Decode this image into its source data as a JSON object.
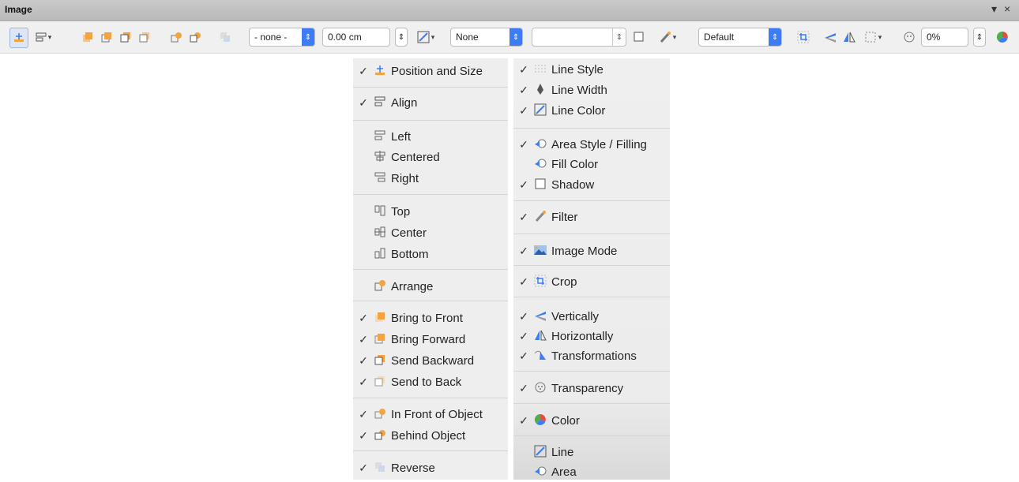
{
  "window": {
    "title": "Image",
    "dropdown_glyph": "▾",
    "close_glyph": "×"
  },
  "toolbar": {
    "line_style_value": "- none -",
    "line_width_value": "0.00 cm",
    "area_style_value": "None",
    "fill_value": "",
    "image_mode_value": "Default",
    "transparency_value": "0%"
  },
  "left_menu": [
    {
      "checked": true,
      "icon": "position-size-icon",
      "label": "Position and Size"
    },
    {
      "checked": true,
      "icon": "align-icon",
      "label": "Align"
    },
    {
      "checked": false,
      "icon": "align-left-icon",
      "label": "Left"
    },
    {
      "checked": false,
      "icon": "align-centered-icon",
      "label": "Centered"
    },
    {
      "checked": false,
      "icon": "align-right-icon",
      "label": "Right"
    },
    {
      "checked": false,
      "icon": "align-top-icon",
      "label": "Top"
    },
    {
      "checked": false,
      "icon": "align-center-icon",
      "label": "Center"
    },
    {
      "checked": false,
      "icon": "align-bottom-icon",
      "label": "Bottom"
    },
    {
      "checked": false,
      "icon": "arrange-icon",
      "label": "Arrange"
    },
    {
      "checked": true,
      "icon": "bring-to-front-icon",
      "label": "Bring to Front"
    },
    {
      "checked": true,
      "icon": "bring-forward-icon",
      "label": "Bring Forward"
    },
    {
      "checked": true,
      "icon": "send-backward-icon",
      "label": "Send Backward"
    },
    {
      "checked": true,
      "icon": "send-to-back-icon",
      "label": "Send to Back"
    },
    {
      "checked": true,
      "icon": "in-front-of-object-icon",
      "label": "In Front of Object"
    },
    {
      "checked": true,
      "icon": "behind-object-icon",
      "label": "Behind Object"
    },
    {
      "checked": true,
      "icon": "reverse-icon",
      "label": "Reverse"
    }
  ],
  "right_menu": [
    {
      "checked": true,
      "icon": "line-style-icon",
      "label": "Line Style"
    },
    {
      "checked": true,
      "icon": "line-width-icon",
      "label": "Line Width"
    },
    {
      "checked": true,
      "icon": "line-color-icon",
      "label": "Line Color"
    },
    {
      "checked": true,
      "icon": "area-style-icon",
      "label": "Area Style / Filling"
    },
    {
      "checked": false,
      "icon": "fill-color-icon",
      "label": "Fill Color"
    },
    {
      "checked": true,
      "icon": "shadow-icon",
      "label": "Shadow"
    },
    {
      "checked": true,
      "icon": "filter-icon",
      "label": "Filter"
    },
    {
      "checked": true,
      "icon": "image-mode-icon",
      "label": "Image Mode"
    },
    {
      "checked": true,
      "icon": "crop-icon",
      "label": "Crop"
    },
    {
      "checked": true,
      "icon": "flip-vertically-icon",
      "label": "Vertically"
    },
    {
      "checked": true,
      "icon": "flip-horizontally-icon",
      "label": "Horizontally"
    },
    {
      "checked": true,
      "icon": "transformations-icon",
      "label": "Transformations"
    },
    {
      "checked": true,
      "icon": "transparency-icon",
      "label": "Transparency"
    },
    {
      "checked": true,
      "icon": "color-icon",
      "label": "Color"
    },
    {
      "checked": false,
      "icon": "line-icon",
      "label": "Line"
    },
    {
      "checked": false,
      "icon": "area-icon",
      "label": "Area"
    }
  ],
  "check_glyph": "✓"
}
